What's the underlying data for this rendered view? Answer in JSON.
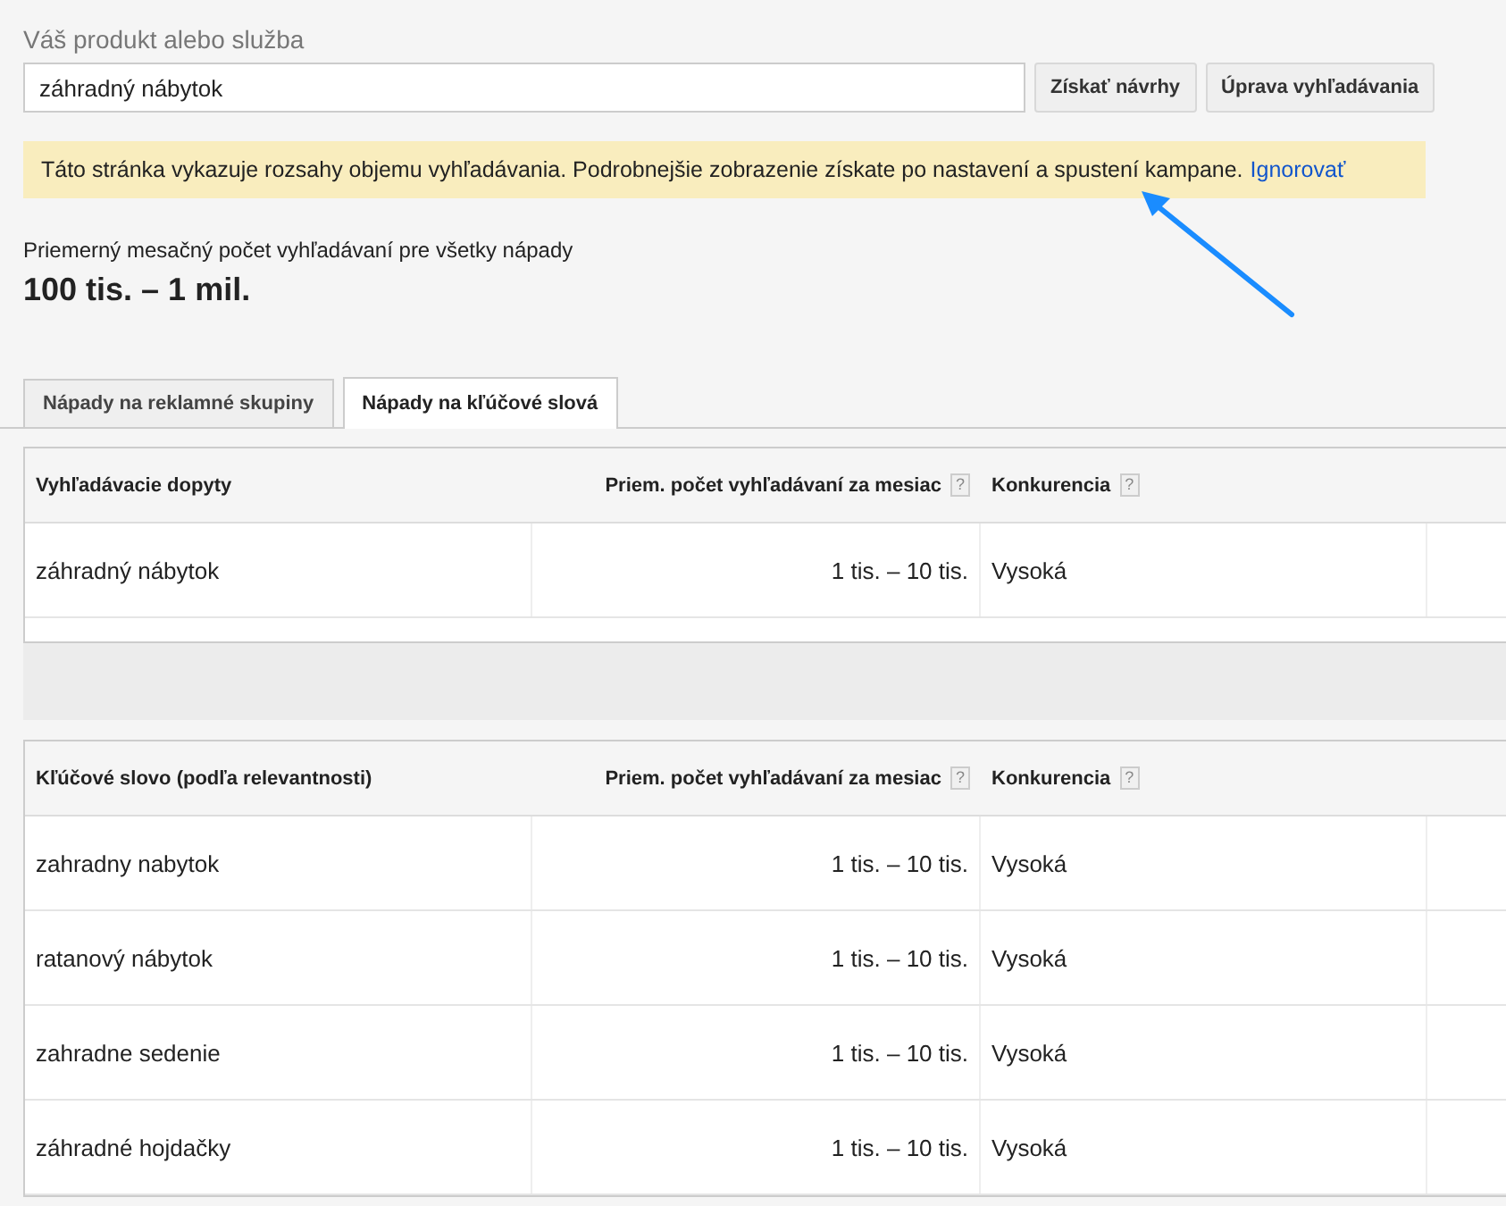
{
  "search": {
    "label": "Váš produkt alebo služba",
    "value": "záhradný nábytok",
    "buttons": [
      "Získať návrhy",
      "Úprava vyhľadávania"
    ]
  },
  "notice": {
    "text": "Táto stránka vykazuje rozsahy objemu vyhľadávania. Podrobnejšie zobrazenie získate po nastavení a spustení kampane.",
    "link": "Ignorovať"
  },
  "summary": {
    "label": "Priemerný mesačný počet vyhľadávaní pre všetky nápady",
    "value": "100 tis. – 1 mil."
  },
  "tabs": [
    {
      "label": "Nápady na reklamné skupiny",
      "selected": false
    },
    {
      "label": "Nápady na kľúčové slová",
      "selected": true
    }
  ],
  "search_terms_table": {
    "columns": [
      {
        "label": "Vyhľadávacie dopyty"
      },
      {
        "label": "Priem. počet vyhľadávaní za mesiac",
        "help": "?"
      },
      {
        "label": "Konkurencia",
        "help": "?"
      }
    ],
    "rows": [
      [
        "záhradný nábytok",
        "1 tis. – 10 tis.",
        "Vysoká"
      ]
    ]
  },
  "keywords_table": {
    "columns": [
      {
        "label": "Kľúčové slovo (podľa relevantnosti)"
      },
      {
        "label": "Priem. počet vyhľadávaní za mesiac",
        "help": "?"
      },
      {
        "label": "Konkurencia",
        "help": "?"
      }
    ],
    "rows": [
      [
        "zahradny nabytok",
        "1 tis. – 10 tis.",
        "Vysoká"
      ],
      [
        "ratanový nábytok",
        "1 tis. – 10 tis.",
        "Vysoká"
      ],
      [
        "zahradne sedenie",
        "1 tis. – 10 tis.",
        "Vysoká"
      ],
      [
        "záhradné hojdačky",
        "1 tis. – 10 tis.",
        "Vysoká"
      ]
    ]
  }
}
